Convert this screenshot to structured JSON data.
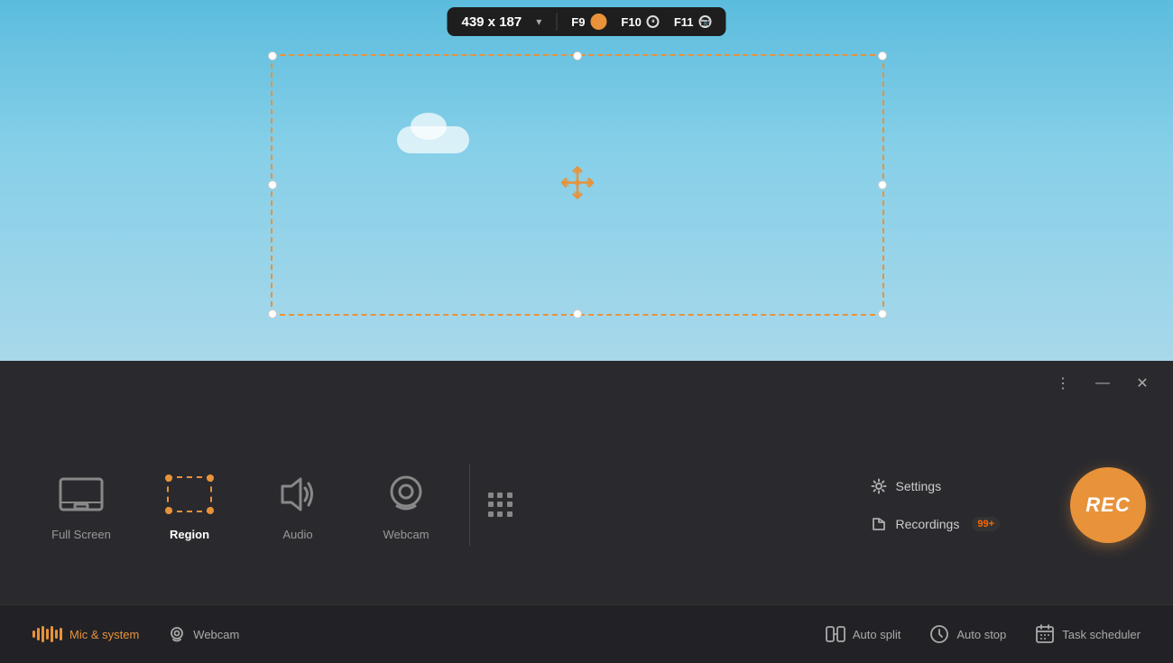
{
  "toolbar": {
    "size_label": "439 x 187",
    "chevron_label": "▾",
    "f9_label": "F9",
    "f10_label": "F10",
    "f11_label": "F11"
  },
  "modes": {
    "full_screen": {
      "label": "Full Screen"
    },
    "region": {
      "label": "Region"
    },
    "audio": {
      "label": "Audio"
    },
    "webcam": {
      "label": "Webcam"
    }
  },
  "right_menu": {
    "settings_label": "Settings",
    "recordings_label": "Recordings",
    "recordings_badge": "99+"
  },
  "rec_button": {
    "label": "REC"
  },
  "bottom_bar": {
    "mic_system_label": "Mic & system",
    "webcam_label": "Webcam",
    "auto_split_label": "Auto split",
    "auto_stop_label": "Auto stop",
    "task_scheduler_label": "Task scheduler"
  },
  "title_bar": {
    "menu_icon": "⋮",
    "minimize_icon": "—",
    "close_icon": "✕"
  }
}
